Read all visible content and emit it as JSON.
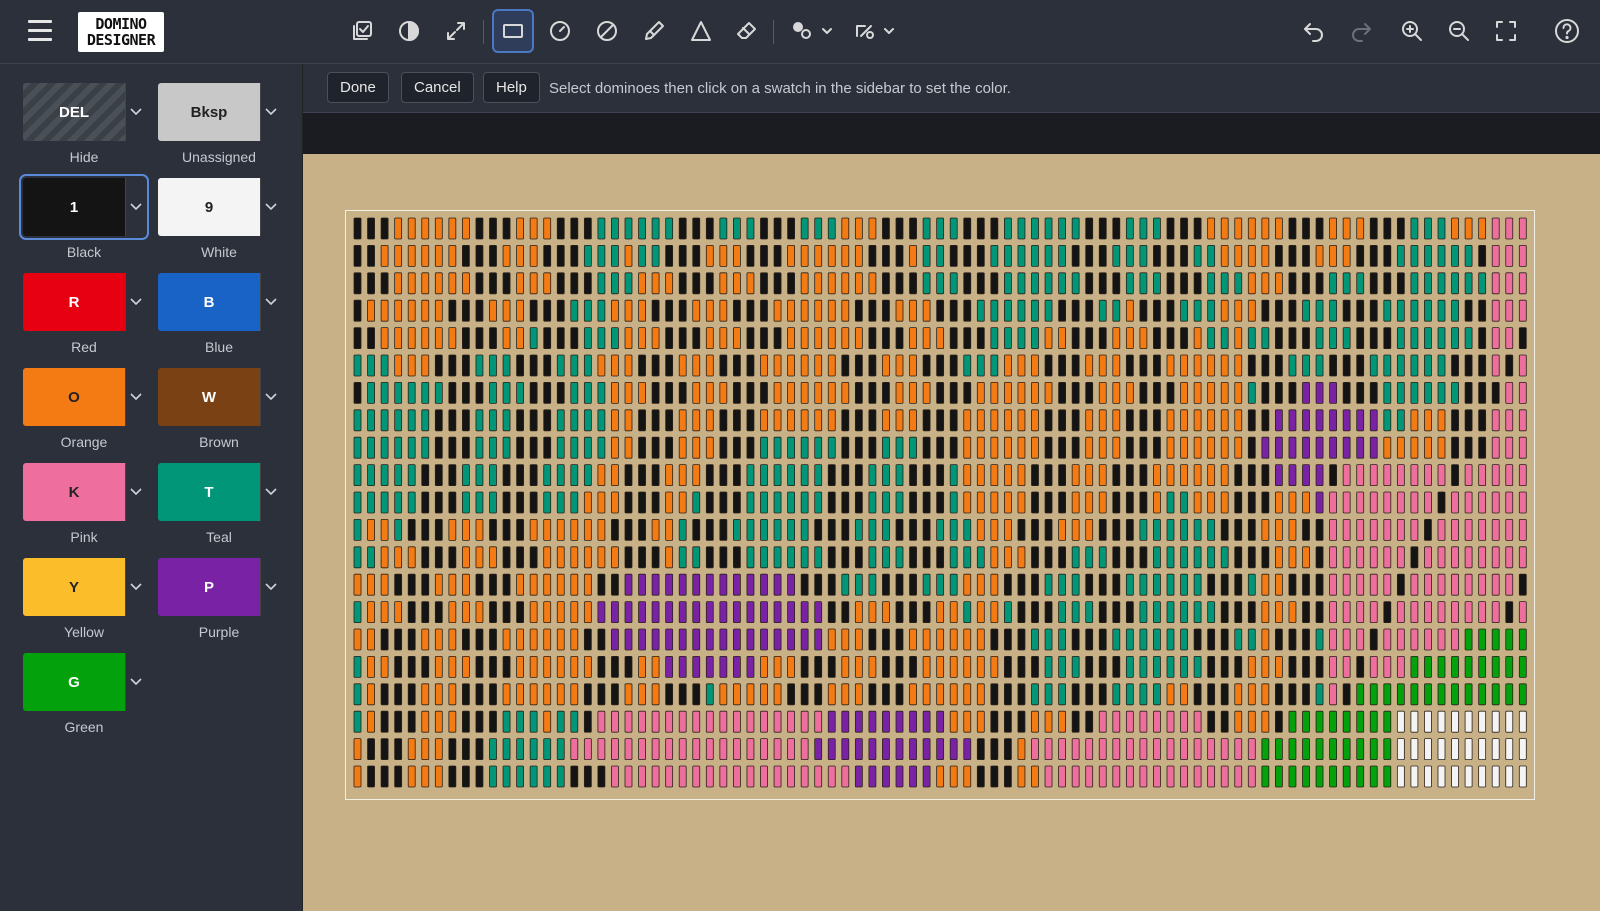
{
  "app": {
    "logo_line1": "DOMINO",
    "logo_line2": "DESIGNER"
  },
  "toolbar": {
    "tools": [
      {
        "name": "select-all-icon",
        "label": "select all"
      },
      {
        "name": "contrast-icon",
        "label": "contrast"
      },
      {
        "name": "resize-icon",
        "label": "resize"
      },
      {
        "name": "rectangle-select-icon",
        "label": "rectangle",
        "active": true
      },
      {
        "name": "circle-select-icon",
        "label": "circle"
      },
      {
        "name": "ban-icon",
        "label": "ban"
      },
      {
        "name": "pencil-icon",
        "label": "pencil"
      },
      {
        "name": "triangle-icon",
        "label": "triangle"
      },
      {
        "name": "eraser-icon",
        "label": "eraser"
      }
    ]
  },
  "actions": {
    "done": "Done",
    "cancel": "Cancel",
    "help": "Help",
    "hint": "Select dominoes then click on a swatch in the sidebar to set the color."
  },
  "swatches": [
    {
      "key": "DEL",
      "label": "Hide",
      "bg": "hatch",
      "fg": "#ffffff"
    },
    {
      "key": "Bksp",
      "label": "Unassigned",
      "bg": "#c8c8c8",
      "fg": "#222222"
    },
    {
      "key": "1",
      "label": "Black",
      "bg": "#141414",
      "fg": "#ffffff",
      "selected": true
    },
    {
      "key": "9",
      "label": "White",
      "bg": "#f4f4f4",
      "fg": "#222222"
    },
    {
      "key": "R",
      "label": "Red",
      "bg": "#e60012",
      "fg": "#ffffff"
    },
    {
      "key": "B",
      "label": "Blue",
      "bg": "#1a63c6",
      "fg": "#ffffff"
    },
    {
      "key": "O",
      "label": "Orange",
      "bg": "#f47a14",
      "fg": "#222222"
    },
    {
      "key": "W",
      "label": "Brown",
      "bg": "#7a4214",
      "fg": "#ffffff"
    },
    {
      "key": "K",
      "label": "Pink",
      "bg": "#ee6f9d",
      "fg": "#222222"
    },
    {
      "key": "T",
      "label": "Teal",
      "bg": "#019678",
      "fg": "#ffffff"
    },
    {
      "key": "Y",
      "label": "Yellow",
      "bg": "#fbbd2a",
      "fg": "#222222"
    },
    {
      "key": "P",
      "label": "Purple",
      "bg": "#7a22a6",
      "fg": "#ffffff"
    },
    {
      "key": "G",
      "label": "Green",
      "bg": "#03a10c",
      "fg": "#ffffff"
    }
  ],
  "colors": {
    "black": "#141414",
    "orange": "#f47a14",
    "teal": "#019678",
    "pink": "#ee6f9d",
    "purple": "#7a22a6",
    "green": "#03a10c",
    "white": "#f4f4f4",
    "board_bg": "#c8b187"
  },
  "domino_grid": {
    "columns": 87,
    "rows": 21
  }
}
